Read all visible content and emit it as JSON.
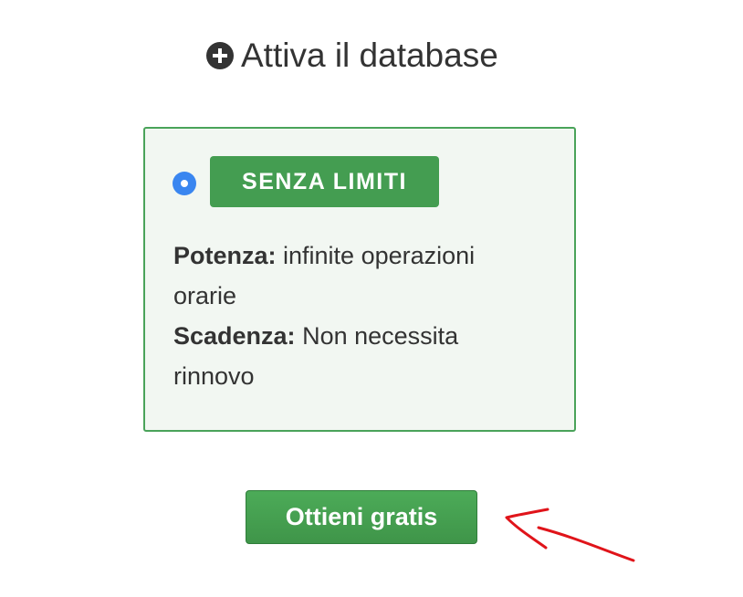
{
  "header": {
    "icon": "plus-circle-icon",
    "title": "Attiva il database"
  },
  "plan": {
    "selected": true,
    "badge_label": "SENZA LIMITI",
    "power_label": "Potenza:",
    "power_value": " infinite operazioni orarie",
    "expiry_label": "Scadenza:",
    "expiry_value": " Non necessita rinnovo"
  },
  "cta": {
    "label": "Ottieni gratis"
  },
  "colors": {
    "accent_green": "#449d51",
    "radio_blue": "#3a86f0",
    "annotation_red": "#e0141a"
  }
}
